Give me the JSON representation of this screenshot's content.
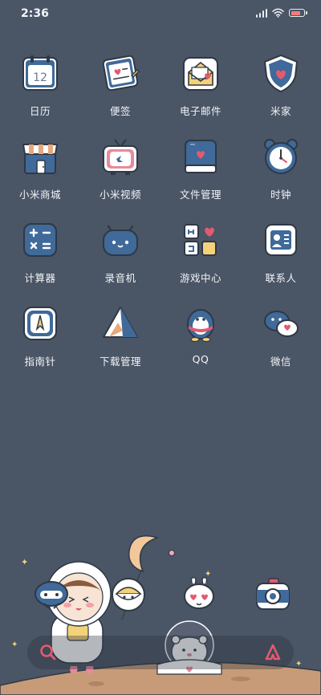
{
  "status_bar": {
    "time": "2:36",
    "battery_level": 0.8,
    "battery_color": "#ff7a7a"
  },
  "apps": [
    [
      {
        "name": "日历",
        "icon": "calendar-icon",
        "day": "12"
      },
      {
        "name": "便签",
        "icon": "notes-icon"
      },
      {
        "name": "电子邮件",
        "icon": "email-icon"
      },
      {
        "name": "米家",
        "icon": "mijia-shield-icon"
      }
    ],
    [
      {
        "name": "小米商城",
        "icon": "store-icon"
      },
      {
        "name": "小米视频",
        "icon": "tv-icon"
      },
      {
        "name": "文件管理",
        "icon": "folder-book-icon"
      },
      {
        "name": "时钟",
        "icon": "alarm-clock-icon"
      }
    ],
    [
      {
        "name": "计算器",
        "icon": "calculator-icon"
      },
      {
        "name": "录音机",
        "icon": "recorder-icon"
      },
      {
        "name": "游戏中心",
        "icon": "game-blocks-icon"
      },
      {
        "name": "联系人",
        "icon": "contacts-icon"
      }
    ],
    [
      {
        "name": "指南针",
        "icon": "compass-icon"
      },
      {
        "name": "下载管理",
        "icon": "download-triangle-icon"
      },
      {
        "name": "QQ",
        "icon": "qq-penguin-icon"
      },
      {
        "name": "微信",
        "icon": "wechat-icon"
      }
    ]
  ],
  "dock": [
    {
      "icon": "phone-dock-icon"
    },
    {
      "icon": "message-dock-icon"
    },
    {
      "icon": "browser-bunny-icon"
    },
    {
      "icon": "camera-dock-icon"
    }
  ],
  "colors": {
    "background": "#4a5566",
    "icon_blue": "#3f6a99",
    "icon_outline": "#2f3845",
    "accent_pink": "#e35a6e"
  }
}
